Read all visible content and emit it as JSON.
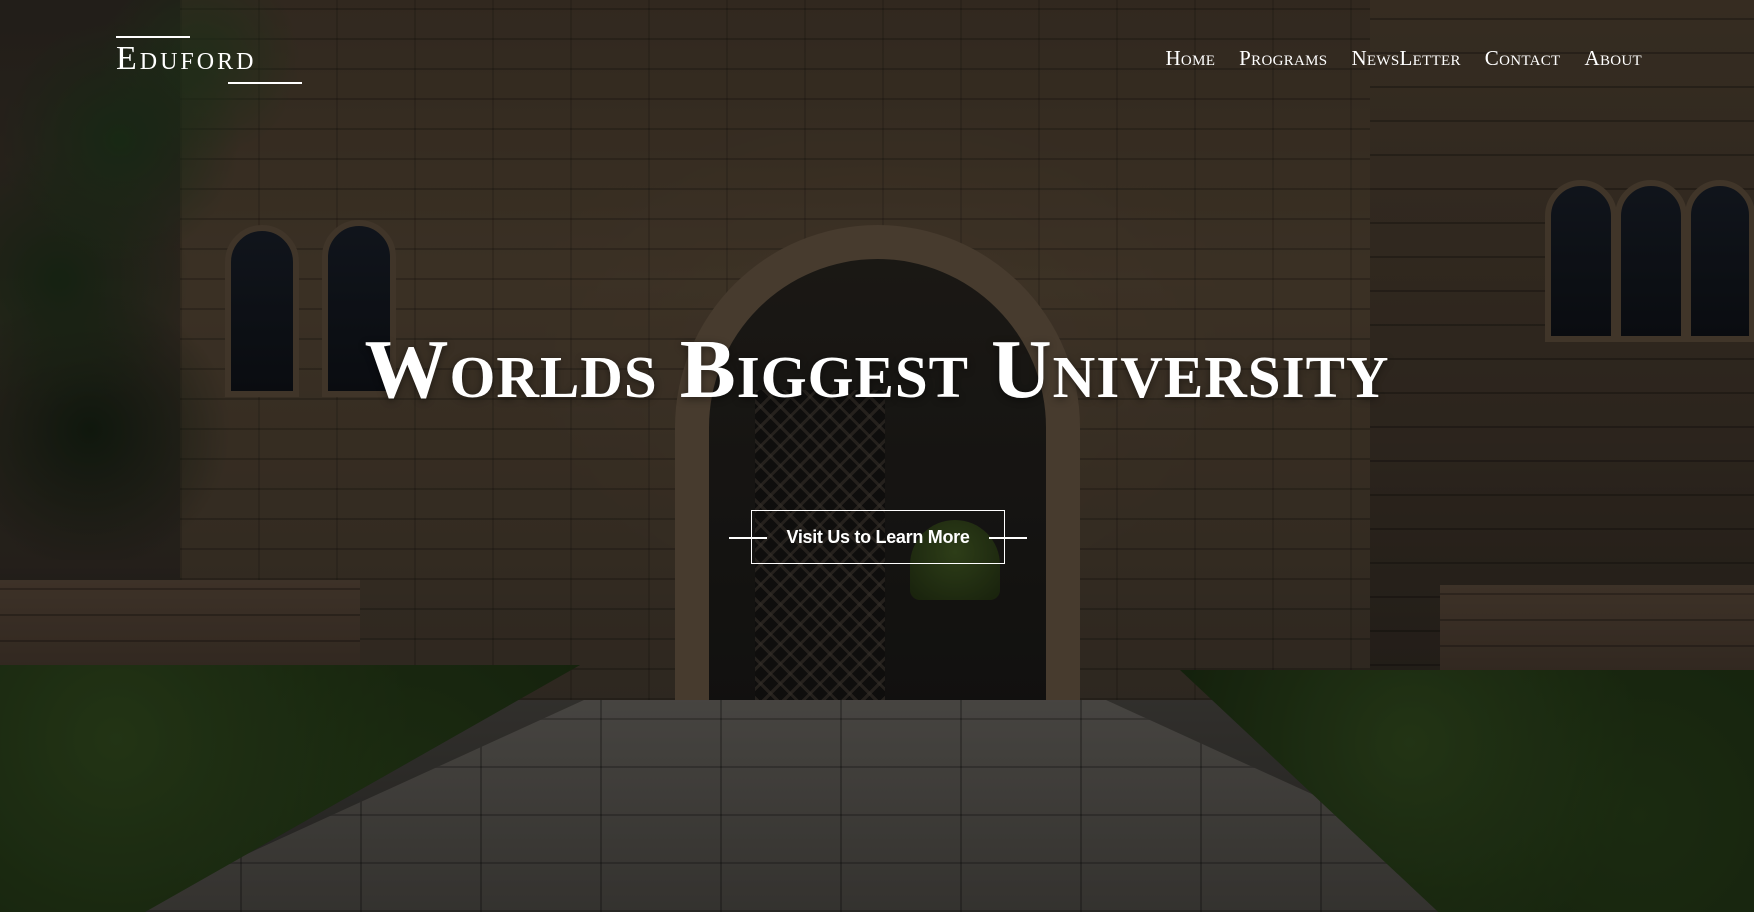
{
  "brand": {
    "logo_text": "Eduford"
  },
  "nav": {
    "items": [
      {
        "label": "Home"
      },
      {
        "label": "Programs"
      },
      {
        "label": "NewsLetter"
      },
      {
        "label": "Contact"
      },
      {
        "label": "About"
      }
    ]
  },
  "hero": {
    "title": "Worlds Biggest University",
    "cta_label": "Visit Us to Learn More"
  },
  "colors": {
    "text": "#ffffff",
    "overlay": "rgba(0,0,0,0.42)"
  }
}
